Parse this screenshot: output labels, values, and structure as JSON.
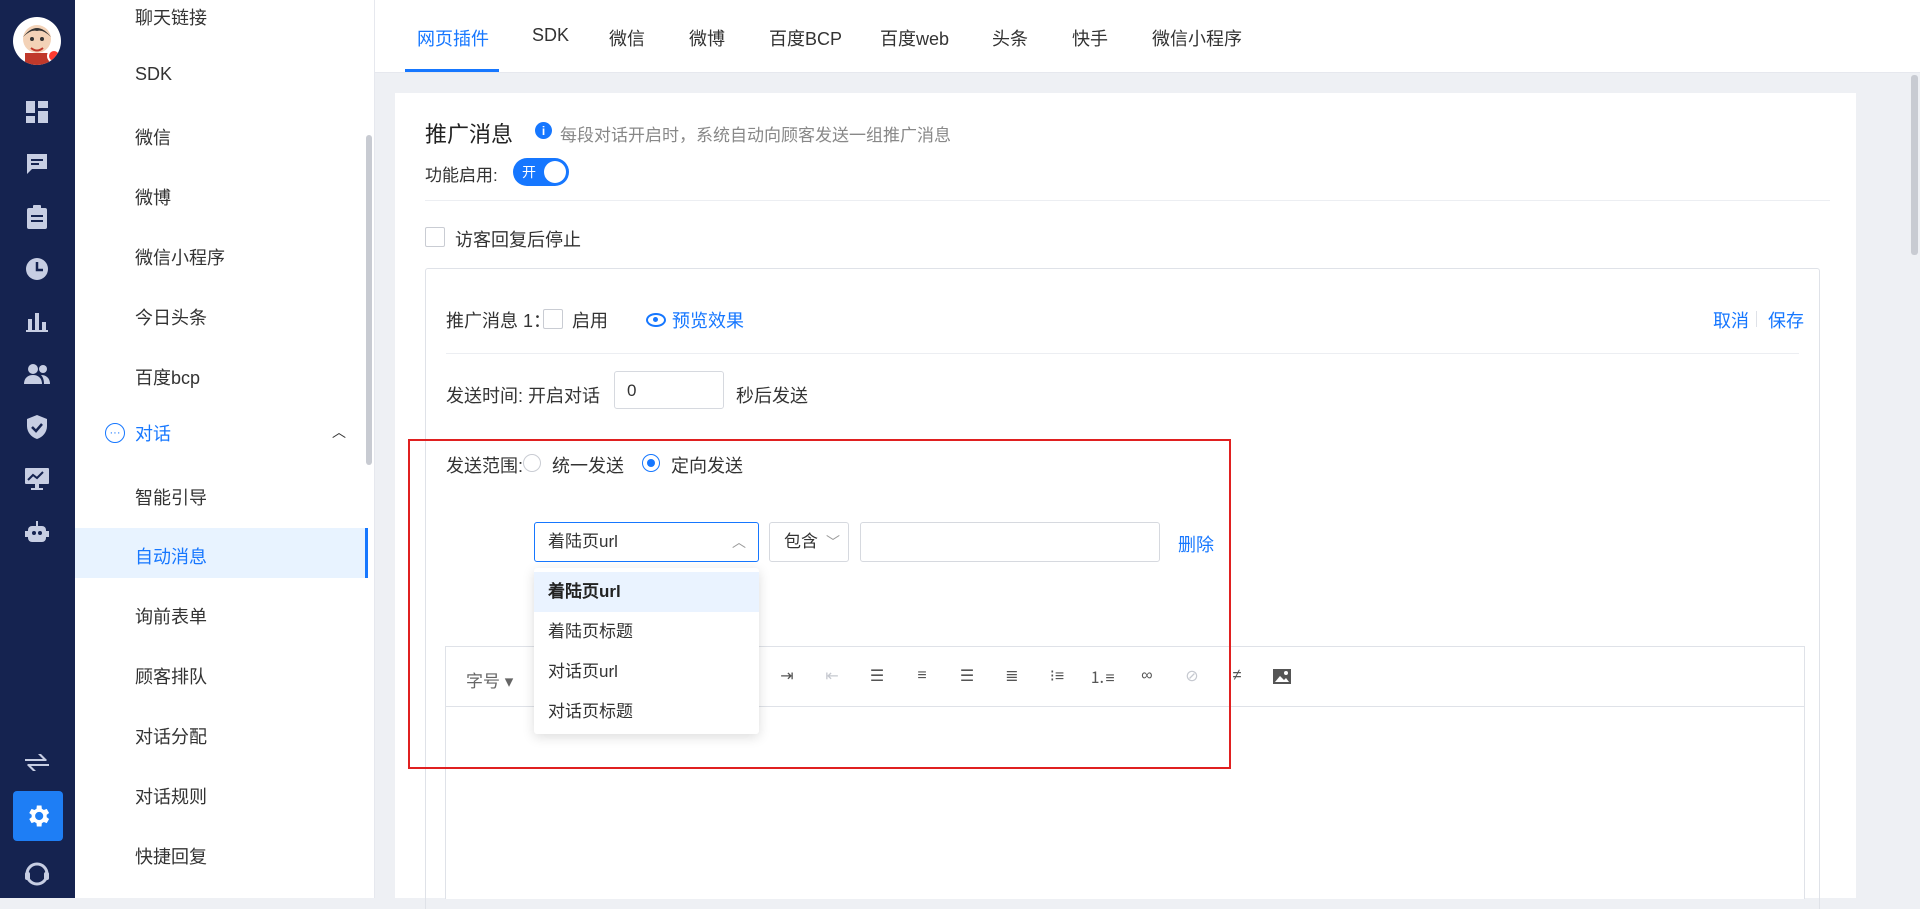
{
  "rail": {
    "icons": [
      "dashboard-icon",
      "chat-icon",
      "clipboard-icon",
      "clock-icon",
      "bar-chart-icon",
      "users-icon",
      "shield-icon",
      "monitor-icon",
      "robot-icon",
      "swap-icon",
      "settings-icon",
      "support-icon"
    ]
  },
  "subnav": {
    "items": [
      "聊天链接",
      "SDK",
      "微信",
      "微博",
      "微信小程序",
      "今日头条",
      "百度bcp"
    ],
    "group_label": "对话",
    "group_items": [
      "智能引导",
      "自动消息",
      "询前表单",
      "顾客排队",
      "对话分配",
      "对话规则",
      "快捷回复"
    ],
    "active_item": "自动消息"
  },
  "tabs": [
    "网页插件",
    "SDK",
    "微信",
    "微博",
    "百度BCP",
    "百度web",
    "头条",
    "快手",
    "微信小程序"
  ],
  "active_tab": "网页插件",
  "card": {
    "title": "推广消息",
    "info_icon": "i",
    "description": "每段对话开启时，系统自动向顾客发送一组推广消息",
    "enable_label": "功能启用:",
    "switch_text": "开",
    "switch_on": true,
    "stop_after_reply_label": "访客回复后停止"
  },
  "message": {
    "title": "推广消息 1：",
    "enable_label": "启用",
    "preview_label": "预览效果",
    "cancel_label": "取消",
    "save_label": "保存",
    "send_time_label": "发送时间:  开启对话",
    "send_time_value": "0",
    "send_time_suffix": "秒后发送",
    "scope_label": "发送范围:",
    "scope_options": [
      "统一发送",
      "定向发送"
    ],
    "scope_selected": "定向发送",
    "condition": {
      "field_value": "着陆页url",
      "operator_value": "包含",
      "match_value": "",
      "delete_label": "删除"
    },
    "field_options": [
      "着陆页url",
      "着陆页标题",
      "对话页url",
      "对话页标题"
    ]
  },
  "editor": {
    "font_size_label": "字号",
    "toolbar_icons": [
      "indent-icon",
      "outdent-icon",
      "align-left-icon",
      "align-center-icon",
      "align-right-icon",
      "align-justify-icon",
      "bullet-list-icon",
      "numbered-list-icon",
      "link-icon",
      "unlink-icon",
      "clear-format-icon",
      "image-icon"
    ]
  },
  "colors": {
    "accent": "#1677ff",
    "rail_bg": "#152350",
    "highlight": "#e02020"
  }
}
